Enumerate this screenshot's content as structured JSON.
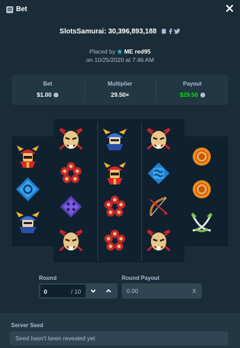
{
  "header": {
    "title": "Bet",
    "close_icon": "close-icon"
  },
  "bet_info": {
    "game": "SlotsSamurai",
    "bet_id": "30,396,893,188",
    "placed_prefix": "Placed by",
    "username": "ME red95",
    "date_line": "on 10/25/2020 at 7:46 AM"
  },
  "stats": {
    "bet_label": "Bet",
    "bet_value": "$1.00",
    "multiplier_label": "Multiplier",
    "multiplier_value": "29.50×",
    "payout_label": "Payout",
    "payout_value": "$29.50"
  },
  "reels": [
    [
      "samurai-helmet-symbol",
      "blue-square-symbol",
      "kabuto-helmet-symbol"
    ],
    [
      "demon-mask-symbol",
      "red-flower-symbol",
      "purple-diamond-symbol",
      "demon-mask-symbol"
    ],
    [
      "kabuto-helmet-symbol",
      "samurai-helmet-symbol",
      "red-flower-symbol",
      "red-flower-symbol"
    ],
    [
      "demon-mask-symbol",
      "blue-wave-symbol",
      "bow-symbol",
      "demon-mask-symbol"
    ],
    [
      "orange-orb-symbol",
      "orange-orb-symbol",
      "crossed-swords-symbol"
    ]
  ],
  "controls": {
    "round_label": "Round",
    "round_value": "0",
    "round_total": "/ 10",
    "round_payout_label": "Round Payout",
    "round_payout_value": "0.00",
    "clear_label": "X"
  },
  "seed": {
    "label": "Server Seed",
    "value": "Seed hasn't been revealed yet"
  },
  "colors": {
    "background": "#1a2c38",
    "panel": "#213743",
    "slot_bg": "#0f212e",
    "input": "#2f4553",
    "muted_text": "#b1bad3",
    "win_green": "#00e701"
  }
}
